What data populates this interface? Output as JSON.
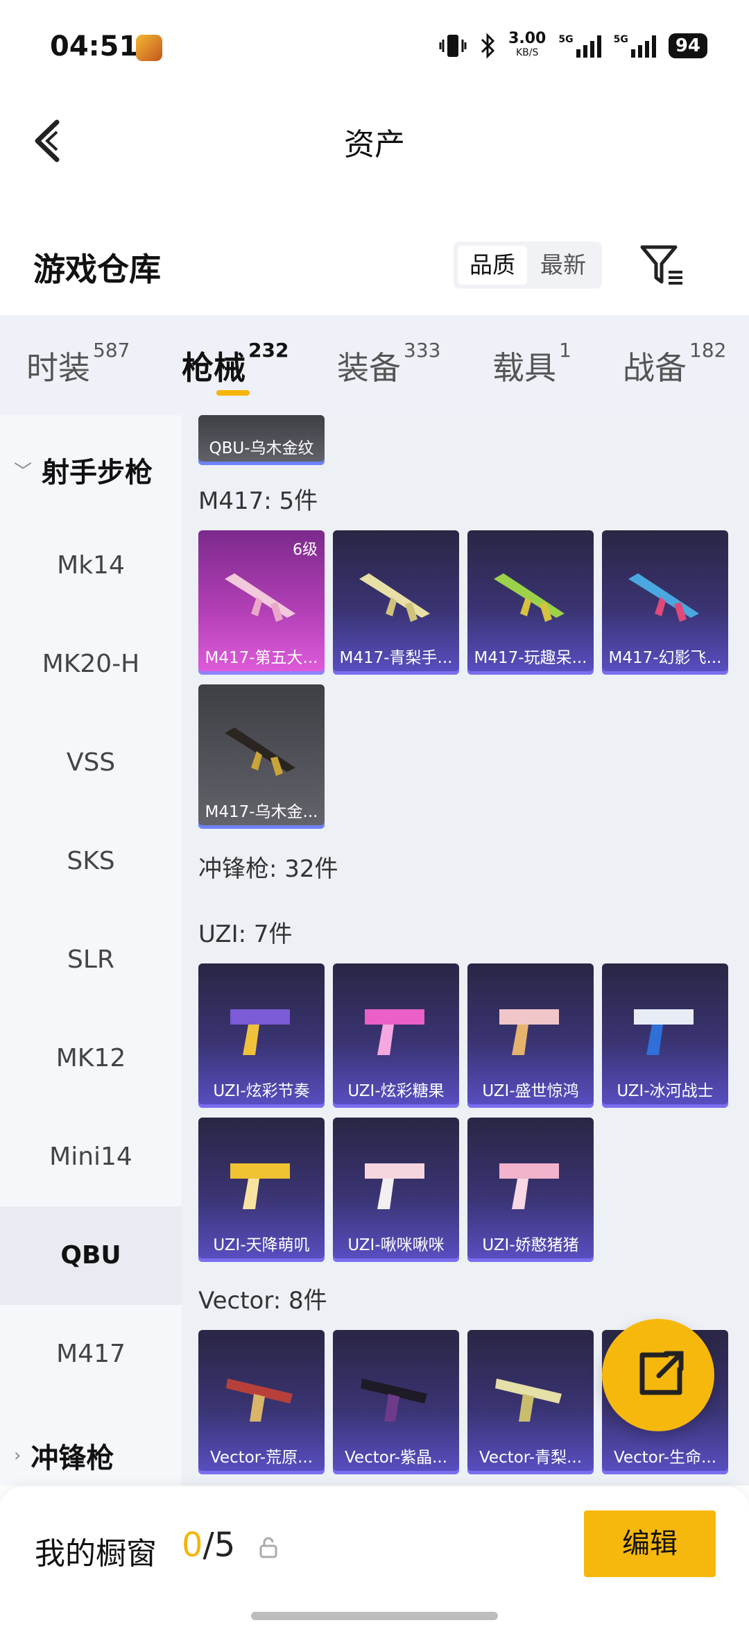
{
  "status_bar": {
    "time": "04:51",
    "speed_value": "3.00",
    "speed_unit": "KB/S",
    "net1": "5G",
    "net2": "5G",
    "battery": "94"
  },
  "header": {
    "title": "资产"
  },
  "warehouse": {
    "title": "游戏仓库",
    "sort_quality": "品质",
    "sort_newest": "最新"
  },
  "tabs": [
    {
      "label": "时装",
      "count": "587"
    },
    {
      "label": "枪械",
      "count": "232"
    },
    {
      "label": "装备",
      "count": "333"
    },
    {
      "label": "载具",
      "count": "1"
    },
    {
      "label": "战备",
      "count": "182"
    }
  ],
  "sidebar": {
    "group1": "射手步枪",
    "items": [
      "Mk14",
      "MK20-H",
      "VSS",
      "SKS",
      "SLR",
      "MK12",
      "Mini14",
      "QBU",
      "M417"
    ],
    "active": "QBU",
    "group2": "冲锋枪"
  },
  "content": {
    "top_partial": "QBU-乌木金纹",
    "m417_title": "M417: 5件",
    "m417": [
      "M417-第五大...",
      "M417-青梨手...",
      "M417-玩趣呆...",
      "M417-幻影飞...",
      "M417-乌木金..."
    ],
    "m417_level": "6级",
    "smg_title": "冲锋枪: 32件",
    "uzi_title": "UZI: 7件",
    "uzi": [
      "UZI-炫彩节奏",
      "UZI-炫彩糖果",
      "UZI-盛世惊鸿",
      "UZI-冰河战士",
      "UZI-天降萌叽",
      "UZI-啾咪啾咪",
      "UZI-娇憨猪猪"
    ],
    "vector_title": "Vector: 8件",
    "vector": [
      "Vector-荒原...",
      "Vector-紫晶...",
      "Vector-青梨...",
      "Vector-生命..."
    ]
  },
  "bottom": {
    "label": "我的橱窗",
    "current": "0",
    "total": "/5",
    "edit": "编辑"
  },
  "colors": {
    "accent": "#f6b80d",
    "card_purple": "#5a4fc4",
    "card_pink": "#e05cdc"
  }
}
